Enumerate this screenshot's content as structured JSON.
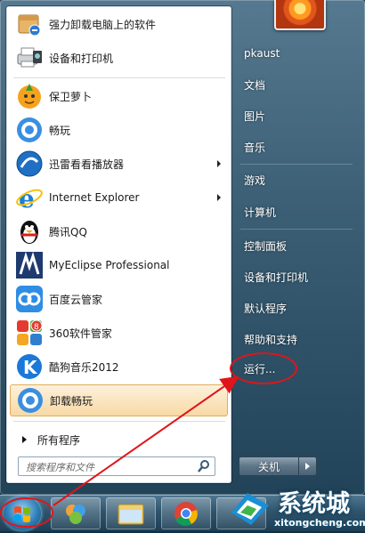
{
  "programs": [
    {
      "label": "强力卸载电脑上的软件",
      "icon": "uninstall-box-icon",
      "has_arrow": false
    },
    {
      "label": "设备和打印机",
      "icon": "printer-icon",
      "has_arrow": false
    },
    {
      "label": "保卫萝卜",
      "icon": "carrot-icon",
      "has_arrow": false
    },
    {
      "label": "畅玩",
      "icon": "changwan-icon",
      "has_arrow": false
    },
    {
      "label": "迅雷看看播放器",
      "icon": "xunlei-player-icon",
      "has_arrow": true
    },
    {
      "label": "Internet Explorer",
      "icon": "internet-explorer-icon",
      "has_arrow": true
    },
    {
      "label": "腾讯QQ",
      "icon": "qq-penguin-icon",
      "has_arrow": false
    },
    {
      "label": "MyEclipse Professional",
      "icon": "myeclipse-icon",
      "has_arrow": false
    },
    {
      "label": "百度云管家",
      "icon": "baidu-cloud-icon",
      "has_arrow": false
    },
    {
      "label": "360软件管家",
      "icon": "360-software-icon",
      "has_arrow": false
    },
    {
      "label": "酷狗音乐2012",
      "icon": "kugou-icon",
      "has_arrow": false
    },
    {
      "label": "卸载畅玩",
      "icon": "uninstall-changwan-icon",
      "has_arrow": false
    }
  ],
  "all_programs_label": "所有程序",
  "search": {
    "placeholder": "搜索程序和文件"
  },
  "right_items": [
    {
      "label": "pkaust"
    },
    {
      "label": "文档"
    },
    {
      "label": "图片"
    },
    {
      "label": "音乐"
    },
    {
      "label": "游戏"
    },
    {
      "label": "计算机"
    },
    {
      "label": "控制面板"
    },
    {
      "label": "设备和打印机"
    },
    {
      "label": "默认程序"
    },
    {
      "label": "帮助和支持"
    },
    {
      "label": "运行..."
    }
  ],
  "shutdown_label": "关机",
  "watermark": {
    "text": "系统城",
    "url": "xitongcheng.com"
  },
  "colors": {
    "annotation": "#e0151a",
    "highlight": "#f8d9a4",
    "pane": "#ffffff"
  }
}
